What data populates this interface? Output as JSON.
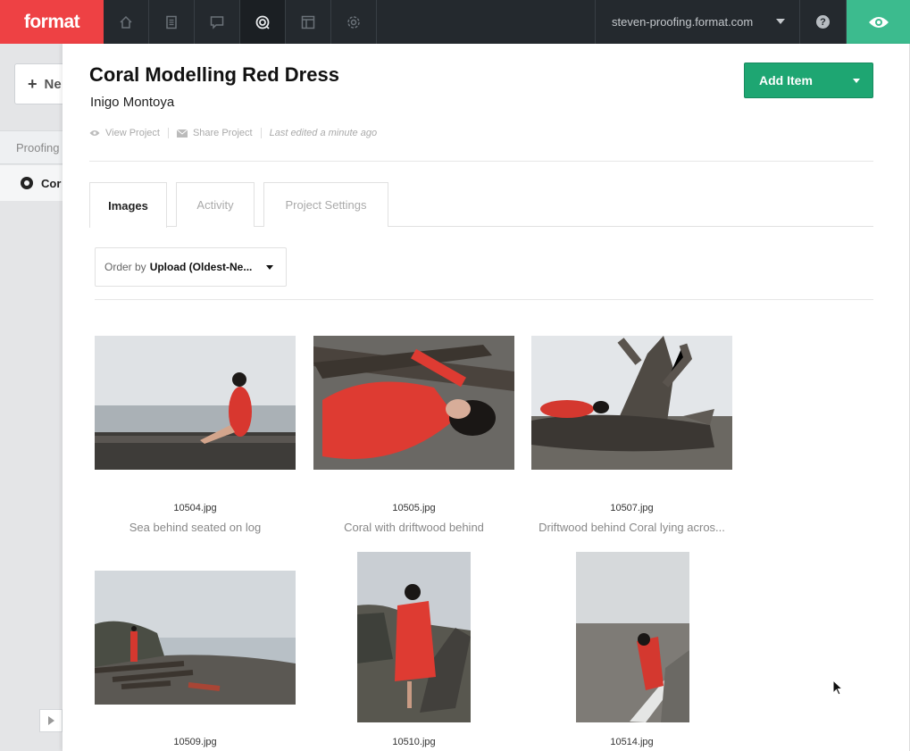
{
  "brand": {
    "logo_text": "format",
    "logo_color": "#ee4144",
    "accent_green": "#3cbb8e"
  },
  "topbar": {
    "nav_icons": [
      "home-icon",
      "pages-icon",
      "comments-icon",
      "proofing-icon",
      "layout-icon",
      "settings-icon"
    ],
    "active_icon": "proofing-icon",
    "site_name": "steven-proofing.format.com",
    "help_label": "?"
  },
  "sidebar": {
    "new_button_label": "Ne",
    "section_label": "Proofing",
    "active_item_label": "Cor"
  },
  "project": {
    "title": "Coral Modelling Red Dress",
    "client": "Inigo Montoya",
    "view_label": "View Project",
    "share_label": "Share Project",
    "last_edited": "Last edited a minute ago",
    "add_item_label": "Add Item"
  },
  "tabs": [
    {
      "label": "Images",
      "active": true
    },
    {
      "label": "Activity",
      "active": false
    },
    {
      "label": "Project Settings",
      "active": false
    }
  ],
  "order": {
    "prefix": "Order by",
    "value": "Upload (Oldest-Ne..."
  },
  "images": [
    {
      "filename": "10504.jpg",
      "caption": "Sea behind seated on log"
    },
    {
      "filename": "10505.jpg",
      "caption": "Coral with driftwood behind"
    },
    {
      "filename": "10507.jpg",
      "caption": "Driftwood behind Coral lying acros..."
    },
    {
      "filename": "10509.jpg",
      "caption": ""
    },
    {
      "filename": "10510.jpg",
      "caption": ""
    },
    {
      "filename": "10514.jpg",
      "caption": ""
    }
  ]
}
